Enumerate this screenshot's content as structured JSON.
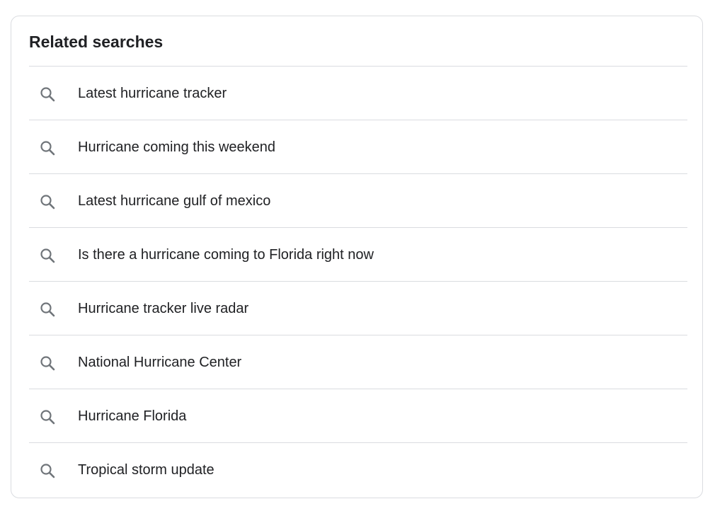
{
  "related": {
    "title": "Related searches",
    "item_icon": "search-icon",
    "items": [
      {
        "label": "Latest hurricane tracker"
      },
      {
        "label": "Hurricane coming this weekend"
      },
      {
        "label": "Latest hurricane gulf of mexico"
      },
      {
        "label": "Is there a hurricane coming to Florida right now"
      },
      {
        "label": "Hurricane tracker live radar"
      },
      {
        "label": "National Hurricane Center"
      },
      {
        "label": "Hurricane Florida"
      },
      {
        "label": "Tropical storm update"
      }
    ]
  },
  "colors": {
    "text": "#202124",
    "icon": "#70757a",
    "divider": "#dadce0"
  }
}
